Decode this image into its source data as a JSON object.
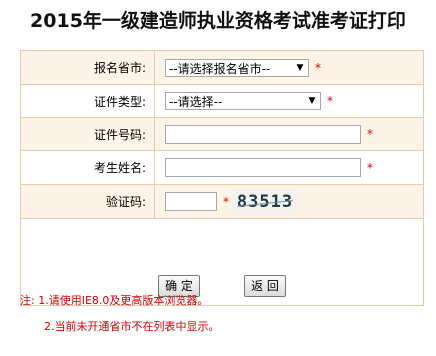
{
  "page": {
    "title": "2015年一级建造师执业资格考试准考证打印"
  },
  "form": {
    "province": {
      "label": "报名省市:",
      "selected": "--请选择报名省市--",
      "required_mark": "*"
    },
    "id_type": {
      "label": "证件类型:",
      "selected": "--请选择--",
      "required_mark": "*"
    },
    "id_number": {
      "label": "证件号码:",
      "value": "",
      "required_mark": "*"
    },
    "name": {
      "label": "考生姓名:",
      "value": "",
      "required_mark": "*"
    },
    "captcha": {
      "label": "验证码:",
      "value": "",
      "required_mark": "*",
      "image_text": "83513"
    }
  },
  "buttons": {
    "confirm": "确 定",
    "back": "返 回"
  },
  "notes": {
    "line1": "注: 1.请使用IE8.0及更高版本浏览器。",
    "line2": "2.当前未开通省市不在列表中显示。"
  },
  "colors": {
    "border": "#e8c9a8",
    "row_shade": "#fdf3e7",
    "required": "#e00000",
    "note_text": "#d40000"
  }
}
